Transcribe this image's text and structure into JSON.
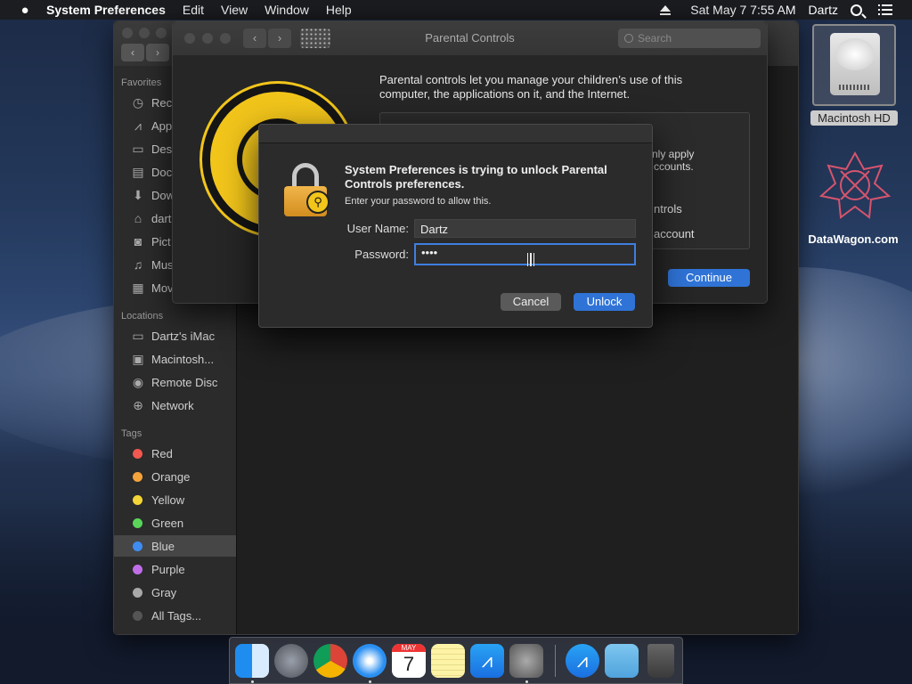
{
  "menubar": {
    "apple": "",
    "items": [
      "System Preferences",
      "Edit",
      "View",
      "Window",
      "Help"
    ],
    "datetime": "Sat May 7  7:55 AM",
    "user": "Dartz"
  },
  "finder": {
    "sections": {
      "favorites": "Favorites",
      "locations": "Locations",
      "tags": "Tags"
    },
    "favorites": [
      {
        "label": "Rec",
        "icon": "recents-icon",
        "glyph": "◷"
      },
      {
        "label": "App",
        "icon": "applications-icon",
        "glyph": "⩘"
      },
      {
        "label": "Des",
        "icon": "desktop-icon",
        "glyph": "▭"
      },
      {
        "label": "Doc",
        "icon": "documents-icon",
        "glyph": "▤"
      },
      {
        "label": "Dow",
        "icon": "downloads-icon",
        "glyph": "⬇"
      },
      {
        "label": "dart",
        "icon": "home-icon",
        "glyph": "⌂"
      },
      {
        "label": "Pict",
        "icon": "pictures-icon",
        "glyph": "◙"
      },
      {
        "label": "Mus",
        "icon": "music-icon",
        "glyph": "♫"
      },
      {
        "label": "Mov",
        "icon": "movies-icon",
        "glyph": "▦"
      }
    ],
    "locations": [
      {
        "label": "Dartz's iMac",
        "icon": "imac-icon",
        "glyph": "▭"
      },
      {
        "label": "Macintosh...",
        "icon": "disk-icon",
        "glyph": "▣"
      },
      {
        "label": "Remote Disc",
        "icon": "remote-disc-icon",
        "glyph": "◉"
      },
      {
        "label": "Network",
        "icon": "network-icon",
        "glyph": "⊕"
      }
    ],
    "tags": [
      {
        "label": "Red",
        "color": "#f2584f"
      },
      {
        "label": "Orange",
        "color": "#f5a33b"
      },
      {
        "label": "Yellow",
        "color": "#f4d537"
      },
      {
        "label": "Green",
        "color": "#5ad55a"
      },
      {
        "label": "Blue",
        "color": "#3f8cf0"
      },
      {
        "label": "Purple",
        "color": "#c06ee8"
      },
      {
        "label": "Gray",
        "color": "#a8a8a8"
      },
      {
        "label": "All Tags...",
        "color": "#555555"
      }
    ],
    "selected_tag": "Blue"
  },
  "parental": {
    "title": "Parental Controls",
    "search_placeholder": "Search",
    "description": "Parental controls let you manage your children’s use of this computer, the applications on it, and the Internet.",
    "box_line1": "nly apply",
    "box_line2": "ccounts.",
    "box_line3": "ntrols",
    "box_line4": "account",
    "continue_label": "Continue"
  },
  "dialog": {
    "message": "System Preferences is trying to unlock Parental Controls preferences.",
    "submessage": "Enter your password to allow this.",
    "username_label": "User Name:",
    "username_value": "Dartz",
    "password_label": "Password:",
    "password_value": "••••",
    "cancel_label": "Cancel",
    "unlock_label": "Unlock"
  },
  "desktop": {
    "hd_label": "Macintosh HD",
    "datawagon_label": "DataWagon.com"
  },
  "dock": {
    "apps": [
      "Finder",
      "Launchpad",
      "Chrome",
      "Safari",
      "Calendar",
      "Notes",
      "App Store",
      "System Preferences",
      "App Store Downloads",
      "Downloads",
      "Trash"
    ],
    "calendar_month": "MAY",
    "calendar_day": "7"
  },
  "colors": {
    "accent": "#2f73d6",
    "focus": "#3f7ee0"
  }
}
